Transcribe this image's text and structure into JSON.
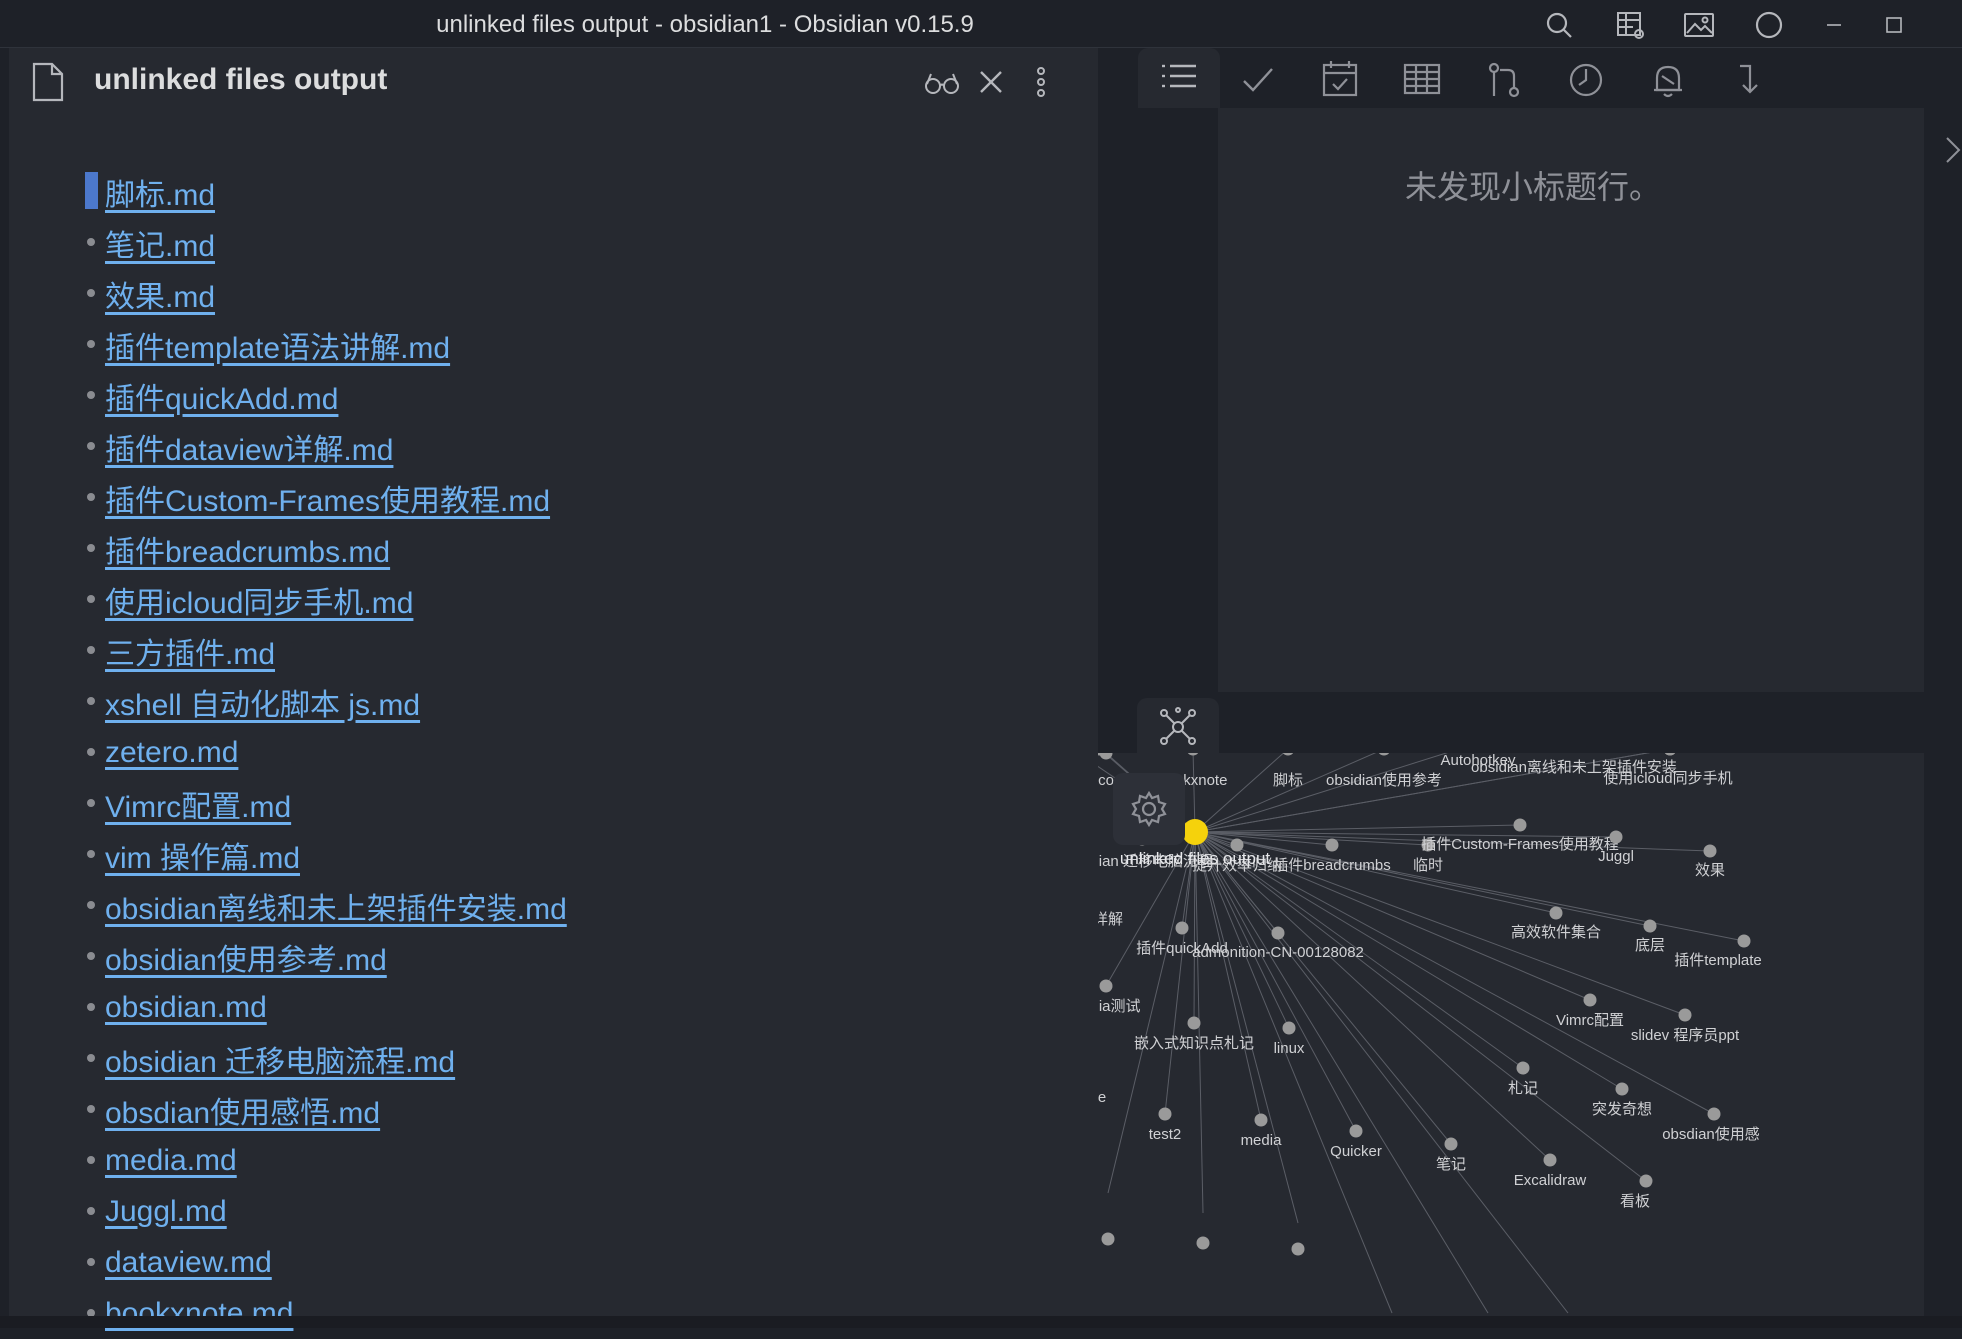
{
  "window": {
    "title": "unlinked files output - obsidian1 - Obsidian v0.15.9",
    "toolbar_icons": [
      "search-icon",
      "dashboard-settings-icon",
      "image-icon",
      "circle-icon",
      "minimize-icon",
      "maximize-icon"
    ]
  },
  "pane": {
    "title": "unlinked files output",
    "header_icons": [
      "reading-view-icon",
      "close-icon",
      "more-options-icon"
    ],
    "files": [
      "脚标.md",
      "笔记.md",
      "效果.md",
      "插件template语法讲解.md",
      "插件quickAdd.md",
      "插件dataview详解.md",
      "插件Custom-Frames使用教程.md",
      "插件breadcrumbs.md",
      "使用icloud同步手机.md",
      "三方插件.md",
      "xshell 自动化脚本 js.md",
      "zetero.md",
      "Vimrc配置.md",
      "vim 操作篇.md",
      "obsidian离线和未上架插件安装.md",
      "obsidian使用参考.md",
      "obsidian.md",
      "obsidian 迁移电脑流程.md",
      "obsdian使用感悟.md",
      "media.md",
      "Juggl.md",
      "dataview.md",
      "bookxnote.md"
    ]
  },
  "right_panel": {
    "tabs": [
      "outline-icon",
      "checkmark-icon",
      "calendar-icon",
      "table-icon",
      "git-icon",
      "clock-icon",
      "bell-icon",
      "redirect-icon"
    ],
    "outline_message": "未发现小标题行。",
    "graph_tab_icon": "graph-view-icon",
    "graph": {
      "center": "unlinked files output",
      "center_color": "#f5d20c",
      "node_color": "#9a9a9a",
      "nodes": [
        "co",
        "ookxnote",
        "脚标",
        "obsidian使用参考",
        "Autohotkey",
        "obsidian离线和未上架插件安装",
        "使用icloud同步手机",
        "idian 迁移电脑流程",
        "提升效率归纳",
        "插件breadcrumbs",
        "临时",
        "插件Custom-Frames使用教程",
        "Juggl",
        "效果",
        "详解",
        "插件quickAdd",
        "admonition-CN-00128082",
        "高效软件集合",
        "底层",
        "插件template",
        "lia测试",
        "嵌入式知识点札记",
        "linux",
        "Vimrc配置",
        "slidev 程序员ppt",
        "e",
        "札记",
        "突发奇想",
        "test2",
        "media",
        "Quicker",
        "笔记",
        "Excalidraw",
        "看板",
        "obsdian使用感"
      ]
    }
  }
}
